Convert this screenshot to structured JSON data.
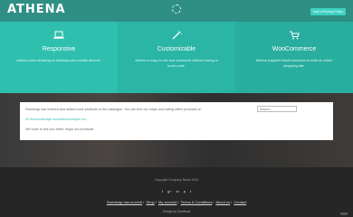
{
  "header": {
    "logo": "ATHENA",
    "privacy_button": "Add a Privacy Policy"
  },
  "features": [
    {
      "icon": "laptop-icon",
      "title": "Responsive",
      "text": "Athena looks amazing on desktops and mobile devices."
    },
    {
      "icon": "magic-wand-icon",
      "title": "Customizable",
      "text": "Athena is easy to use and customize without having to touch code."
    },
    {
      "icon": "shopping-cart-icon",
      "title": "WooCommerce",
      "text": "Athena supports WooCommerce to build an online shopping site."
    }
  ],
  "content": {
    "line1": "Sweetcap has evolved and added more products to the catalogue. You can find our maps and eating offers products on",
    "link": "42.thenewlifestyle.sociedicameninyle.hd.t",
    "line3": "We hope to see you there, enjoy our products!",
    "search_placeholder": "Search..."
  },
  "footer": {
    "copyright": "Copyright Company Name 2019",
    "social": [
      "f",
      "g+",
      "in",
      "p",
      "t"
    ],
    "links": [
      "Sweetcap has moved!",
      "Shop",
      "My account",
      "Terms & Conditions",
      "About us",
      "Contact"
    ],
    "designed_by": "Design by Sweetcat"
  },
  "colors": {
    "header": "#2f8f84",
    "accent": "#2fbfae",
    "footer": "#262626"
  }
}
